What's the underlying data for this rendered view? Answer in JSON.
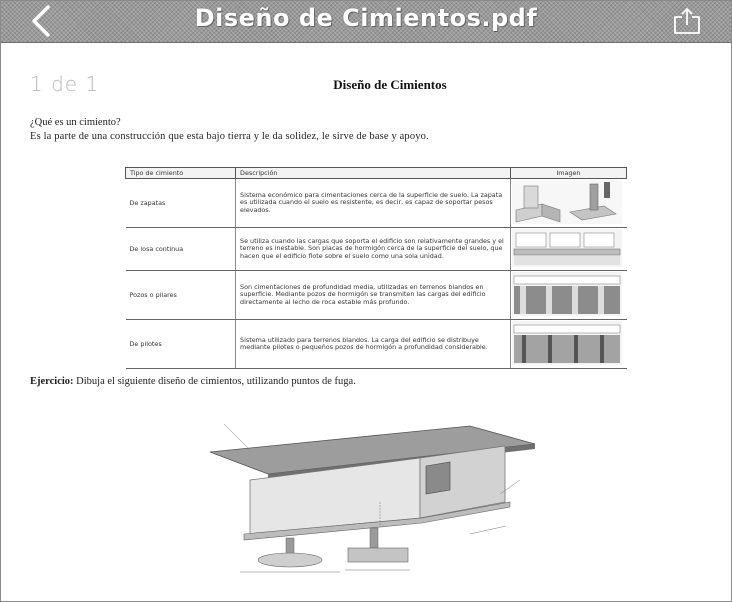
{
  "header": {
    "back_icon": "chevron-left-icon",
    "title": "Diseño de Cimientos.pdf",
    "share_icon": "share-icon"
  },
  "page": {
    "counter": "1 de 1",
    "title": "Diseño de Cimientos",
    "question": "¿Qué es un cimiento?",
    "answer": "Es la parte de una construcción que esta bajo tierra y le da solidez, le sirve de base y apoyo."
  },
  "table": {
    "headers": [
      "Tipo de cimiento",
      "Descripción",
      "Imagen"
    ],
    "rows": [
      {
        "type": "De zapatas",
        "description": "Sistema económico para cimentaciones cerca de la superficie de suelo. La zapata es utilizada cuando el suelo es resistente, es decir, es capaz de soportar pesos elevados."
      },
      {
        "type": "De losa continua",
        "description": "Se utiliza cuando las cargas que soporta el edificio son relativamente grandes y el terreno es inestable. Son placas de hormigón cerca de la superficie del suelo, que hacen que el edificio flote sobre el suelo como una sola unidad."
      },
      {
        "type": "Pozos o pilares",
        "description": "Son cimentaciones de profundidad media, utilizadas en terrenos blandos en superficie. Mediante pozos de hormigón se transmiten las cargas del edificio directamente al lecho de roca estable más profundo."
      },
      {
        "type": "De pilotes",
        "description": "Sistema utilizado para terrenos blandos. La carga del edificio se distribuye mediante pilotes o pequeños pozos de hormigón a profundidad considerable."
      }
    ]
  },
  "exercise": {
    "label": "Ejercicio:",
    "text": " Dibuja el siguiente diseño de cimientos, utilizando puntos de fuga."
  },
  "colors": {
    "header_bg": "#9a9a9a",
    "header_text": "#ffffff",
    "page_bg": "#ffffff"
  }
}
